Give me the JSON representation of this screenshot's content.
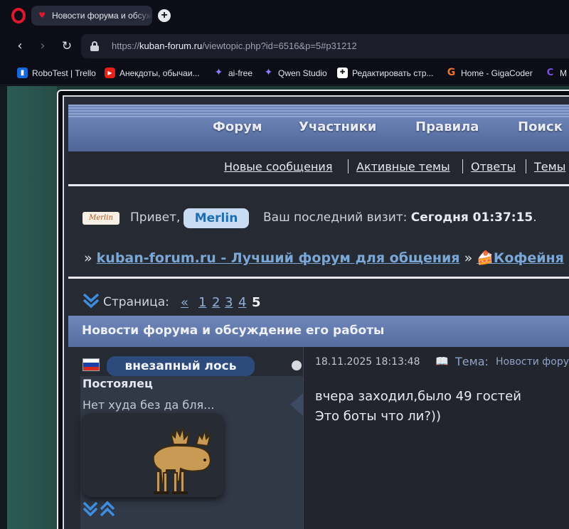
{
  "browser": {
    "tab_title": "Новости форума и обсуждение его работы",
    "new_tab_symbol": "+",
    "url_scheme": "https://",
    "url_host": "kuban-forum.ru",
    "url_path": "/viewtopic.php?id=6516&p=5#p31212",
    "bookmarks": [
      {
        "label": "RoboTest | Trello",
        "icon": "trello-icon",
        "color": "#1868db"
      },
      {
        "label": "Анекдоты, обычаи...",
        "icon": "youtube-icon",
        "color": "#e62117"
      },
      {
        "label": "ai-free",
        "icon": "qwen-icon",
        "color": "#6a5cff"
      },
      {
        "label": "Qwen Studio",
        "icon": "qwen-icon",
        "color": "#6a5cff"
      },
      {
        "label": "Редактировать стр...",
        "icon": "editor-icon",
        "color": "#ffffff"
      },
      {
        "label": "Home - GigaCoder",
        "icon": "gigacoder-icon",
        "color": "#e8742f"
      },
      {
        "label": "M",
        "icon": "m-icon",
        "color": "#6f45d8"
      }
    ]
  },
  "forum": {
    "nav": [
      "Форум",
      "Участники",
      "Правила",
      "Поиск"
    ],
    "subnav": [
      "Новые сообщения",
      "Активные темы",
      "Ответы",
      "Темы"
    ],
    "welcome": {
      "avatar_text": "Merlin",
      "greeting": "Привет,",
      "username": "Merlin",
      "last_visit_label": "Ваш последний визит:",
      "last_visit_value": "Сегодня 01:37:15",
      "period": "."
    },
    "breadcrumbs": {
      "sep": "»",
      "home": "kuban-forum.ru - Лучший форум для общения",
      "section": "🍰Кофейня"
    },
    "pager": {
      "label": "Страница:",
      "prev": "«",
      "pages": [
        "1",
        "2",
        "3",
        "4"
      ],
      "current": "5"
    },
    "topic_title": "Новости форума и обсуждение его работы",
    "post": {
      "author": "внезапный лось",
      "rank": "Постоялец",
      "signature": "Нет худа без да бля...",
      "date": "18.11.2025 18:13:48",
      "topic_label": "Тема:",
      "topic_value": "Новости форума и обсуждение его работы",
      "lines": [
        "вчера заходил,было 49 гостей",
        "Это боты что ли?))"
      ]
    }
  },
  "colors": {
    "accent": "#6f87bb",
    "link": "#7ba7d6",
    "badge": "#2d4a7c"
  }
}
